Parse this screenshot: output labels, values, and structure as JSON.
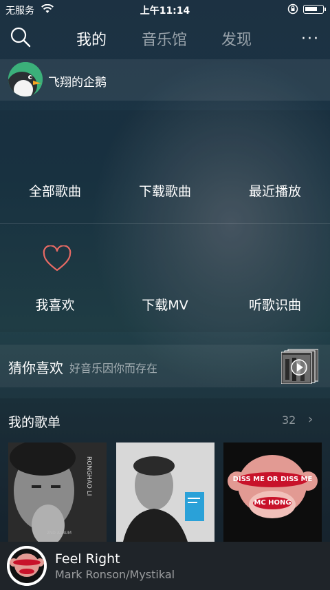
{
  "status_bar": {
    "carrier": "无服务",
    "time": "上午11:14",
    "battery_level": 0.75
  },
  "nav": {
    "tabs": [
      "我的",
      "音乐馆",
      "发现"
    ],
    "more": "···"
  },
  "user": {
    "name": "飞翔的企鹅"
  },
  "grid": {
    "row1": [
      "全部歌曲",
      "下载歌曲",
      "最近播放"
    ],
    "row2": [
      "我喜欢",
      "下载MV",
      "听歌识曲"
    ]
  },
  "guess": {
    "title": "猜你喜欢",
    "subtitle": "好音乐因你而存在"
  },
  "playlists": {
    "title": "我的歌单",
    "count": "32",
    "covers": [
      {
        "text": "RONGHAO LI",
        "small": "2ND ALBUM"
      },
      {
        "text": "",
        "small": ""
      },
      {
        "text": "DISS ME OR DISS ME",
        "small": "MC HONG"
      }
    ]
  },
  "player": {
    "song": "Feel Right",
    "artist": "Mark Ronson/Mystikal"
  },
  "colors": {
    "accent_heart": "#e86a64",
    "brand_green": "#3bb07a",
    "cover3_red": "#c8122a"
  }
}
